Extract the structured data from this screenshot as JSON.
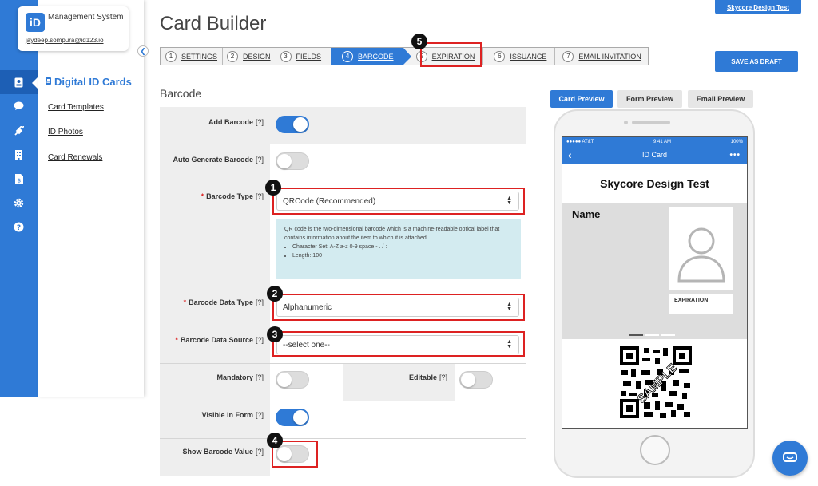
{
  "brand": {
    "logo": "iD",
    "title": "Management System",
    "email": "jaydeep.sompura@id123.io"
  },
  "iconbar": {
    "icons": [
      "id-card-icon",
      "chat-icon",
      "plug-icon",
      "building-icon",
      "document-dollar-icon",
      "gear-icon",
      "help-icon"
    ]
  },
  "sidepanel": {
    "heading": "Digital ID Cards",
    "links": [
      "Card Templates",
      "ID Photos",
      "Card Renewals"
    ]
  },
  "page": {
    "title": "Card Builder",
    "section_title": "Barcode"
  },
  "top_button": "Skycore Design Test",
  "save_draft": "SAVE AS DRAFT",
  "steps": [
    {
      "num": "1",
      "label": "SETTINGS"
    },
    {
      "num": "2",
      "label": "DESIGN"
    },
    {
      "num": "3",
      "label": "FIELDS"
    },
    {
      "num": "4",
      "label": "BARCODE"
    },
    {
      "num": "5",
      "label": "EXPIRATION"
    },
    {
      "num": "6",
      "label": "ISSUANCE"
    },
    {
      "num": "7",
      "label": "EMAIL INVITATION"
    }
  ],
  "form": {
    "add_barcode": {
      "label": "Add Barcode",
      "help": "[?]",
      "on": true
    },
    "auto_generate": {
      "label": "Auto Generate Barcode",
      "help": "[?]",
      "on": false
    },
    "barcode_type": {
      "required": "*",
      "label": "Barcode Type",
      "help": "[?]",
      "value": "QRCode (Recommended)"
    },
    "info": {
      "text": "QR code is the two-dimensional barcode which is a machine-readable optical label that contains information about the item to which it is attached.",
      "bullets": [
        "Character Set: A-Z a-z 0-9 space - . / :",
        "Length: 100"
      ]
    },
    "data_type": {
      "required": "*",
      "label": "Barcode Data Type",
      "help": "[?]",
      "value": "Alphanumeric"
    },
    "data_source": {
      "required": "*",
      "label": "Barcode Data Source",
      "help": "[?]",
      "value": "--select one--"
    },
    "mandatory": {
      "label": "Mandatory",
      "help": "[?]",
      "on": false
    },
    "editable": {
      "label": "Editable",
      "help": "[?]",
      "on": false
    },
    "visible": {
      "label": "Visible in Form",
      "help": "[?]",
      "on": true
    },
    "show_value": {
      "label": "Show Barcode Value",
      "help": "[?]",
      "on": false
    }
  },
  "annotations": [
    "1",
    "2",
    "3",
    "4",
    "5"
  ],
  "preview_tabs": [
    "Card Preview",
    "Form Preview",
    "Email Preview"
  ],
  "phone": {
    "carrier": "●●●●● AT&T",
    "time": "9:41 AM",
    "battery": "100%",
    "nav_title": "ID Card",
    "card_title": "Skycore Design Test",
    "name_label": "Name",
    "expiration_label": "EXPIRATION",
    "qr_watermark": "SAMPLE"
  },
  "colors": {
    "primary": "#2f7ad6",
    "annotation_red": "#d22222",
    "info_bg": "#d3ebf0"
  }
}
